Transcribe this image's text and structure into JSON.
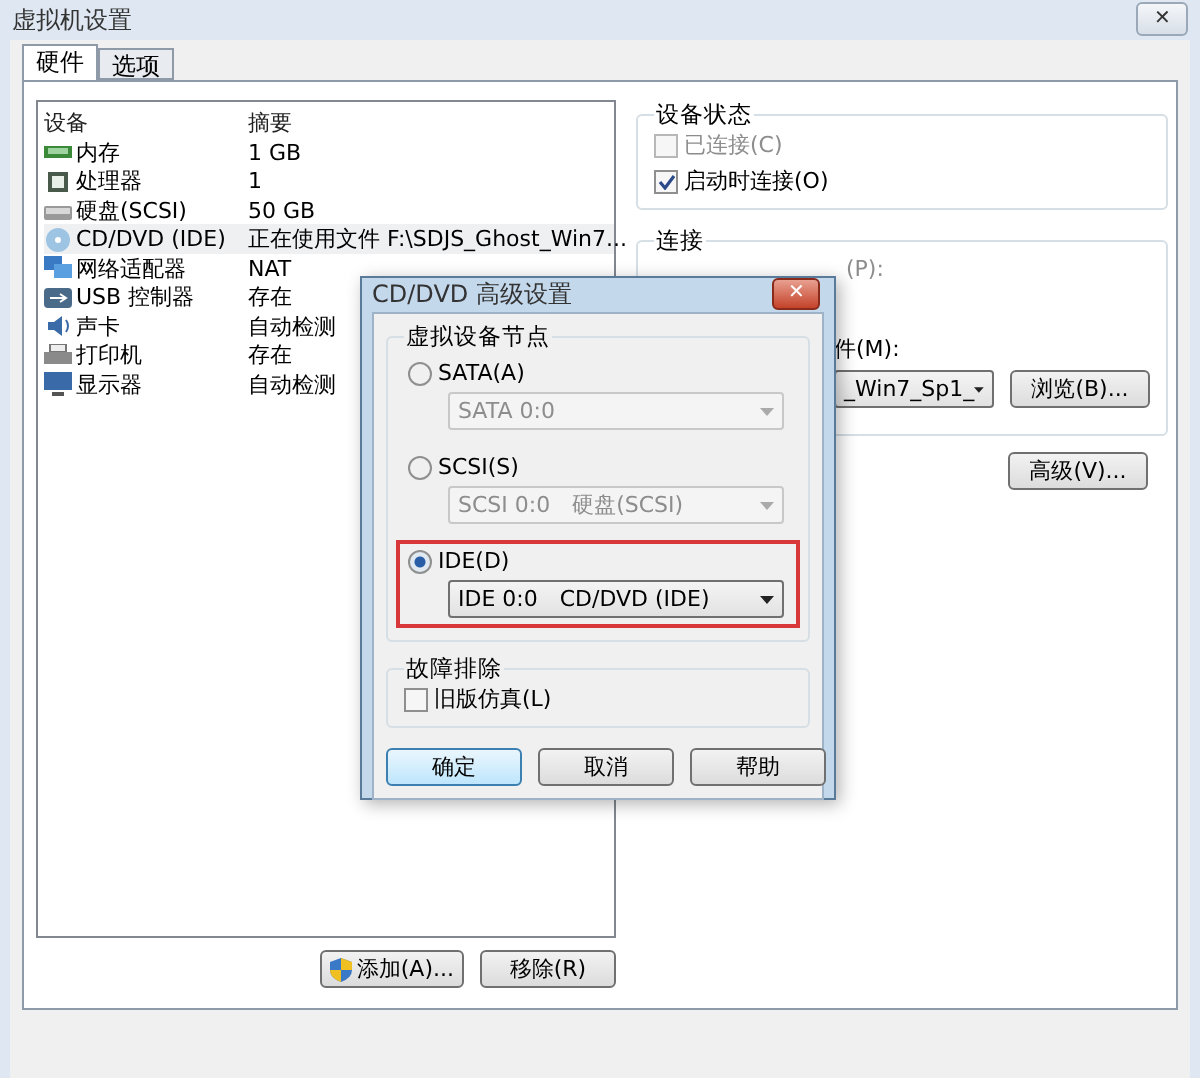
{
  "window": {
    "title": "虚拟机设置",
    "close": "✕"
  },
  "tabs": [
    {
      "label": "硬件",
      "selected": true
    },
    {
      "label": "选项",
      "selected": false
    }
  ],
  "devices": {
    "columns": [
      "设备",
      "摘要"
    ],
    "rows": [
      {
        "kind": "memory",
        "name": "内存",
        "summary": "1 GB",
        "selected": false
      },
      {
        "kind": "cpu",
        "name": "处理器",
        "summary": "1",
        "selected": false
      },
      {
        "kind": "disk",
        "name": "硬盘(SCSI)",
        "summary": "50 GB",
        "selected": false
      },
      {
        "kind": "disc",
        "name": "CD/DVD (IDE)",
        "summary": "正在使用文件 F:\\SDJS_Ghost_Win7...",
        "selected": true
      },
      {
        "kind": "network",
        "name": "网络适配器",
        "summary": "NAT",
        "selected": false
      },
      {
        "kind": "usb",
        "name": "USB 控制器",
        "summary": "存在",
        "selected": false
      },
      {
        "kind": "sound",
        "name": "声卡",
        "summary": "自动检测",
        "selected": false
      },
      {
        "kind": "printer",
        "name": "打印机",
        "summary": "存在",
        "selected": false
      },
      {
        "kind": "display",
        "name": "显示器",
        "summary": "自动检测",
        "selected": false
      }
    ],
    "buttons": [
      "添加(A)...",
      "移除(R)"
    ]
  },
  "device_status": {
    "title": "设备状态",
    "options": [
      {
        "label": "已连接(C)",
        "checked": false,
        "disabled": true
      },
      {
        "label": "启动时连接(O)",
        "checked": true,
        "disabled": false
      }
    ]
  },
  "connection": {
    "title": "连接",
    "physical_label": "(P):",
    "iso_label": "件(M):",
    "iso_value": "_Win7_Sp1_",
    "browse": "浏览(B)..."
  },
  "advanced_button": "高级(V)...",
  "dialog": {
    "title": "CD/DVD 高级设置",
    "close": "✕",
    "node_title": "虚拟设备节点",
    "nodes": [
      {
        "label": "SATA(A)",
        "selected": false,
        "highlighted": false,
        "value": "SATA 0:0"
      },
      {
        "label": "SCSI(S)",
        "selected": false,
        "highlighted": false,
        "value": "SCSI 0:0　硬盘(SCSI)"
      },
      {
        "label": "IDE(D)",
        "selected": true,
        "highlighted": true,
        "value": "IDE 0:0　CD/DVD (IDE)"
      }
    ],
    "troubleshoot_title": "故障排除",
    "legacy": {
      "label": "旧版仿真(L)",
      "checked": false
    },
    "buttons": [
      {
        "label": "确定",
        "default": true
      },
      {
        "label": "取消",
        "default": false
      },
      {
        "label": "帮助",
        "default": false
      }
    ]
  }
}
